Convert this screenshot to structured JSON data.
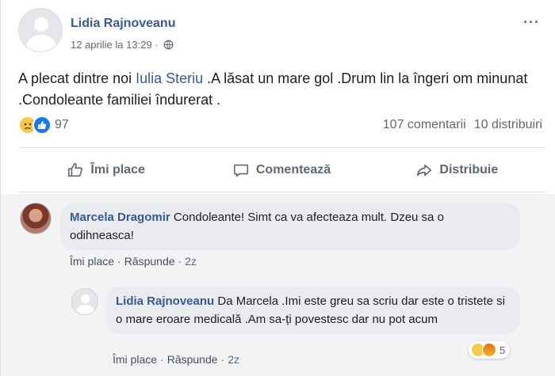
{
  "post": {
    "author": "Lidia Rajnoveanu",
    "timestamp": "12 aprilie la 13:29 ·",
    "more_label": "···",
    "text_before": "A plecat dintre noi ",
    "mention": "Iulia Steriu",
    "text_after": " .A lăsat un mare gol .Drum lin la îngeri om minunat .Condoleante familiei îndurerat .",
    "reaction_count": "97",
    "comments_count": "107 comentarii",
    "shares_count": "10 distribuiri"
  },
  "actions": {
    "like": "Îmi place",
    "comment": "Comentează",
    "share": "Distribuie"
  },
  "comments": [
    {
      "author": "Marcela Dragomir",
      "text": "Condoleante! Simt ca va afecteaza mult. Dzeu sa o odihneasca!",
      "like": "Îmi place",
      "reply": "Răspunde",
      "age": "2z"
    },
    {
      "author": "Lidia Rajnoveanu",
      "text": "Da Marcela .Imi este greu sa scriu dar este o tristete si o mare eroare medicală .Am sa-ți povestesc dar nu pot acum",
      "like": "Îmi place",
      "reply": "Răspunde",
      "age": "2z",
      "reaction_count": "5"
    }
  ],
  "colors": {
    "link": "#385898",
    "muted": "#606770",
    "bubble": "#e9ebee",
    "like_blue": "#1877f2"
  }
}
